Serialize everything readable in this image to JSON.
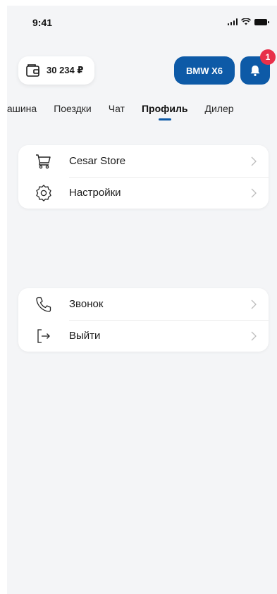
{
  "status_bar": {
    "time": "9:41"
  },
  "header": {
    "balance": "30 234 ₽",
    "car_label": "BMW X6",
    "notification_count": "1"
  },
  "tabs": [
    {
      "label": "Машина",
      "active": false
    },
    {
      "label": "Поездки",
      "active": false
    },
    {
      "label": "Чат",
      "active": false
    },
    {
      "label": "Профиль",
      "active": true
    },
    {
      "label": "Дилер",
      "active": false
    }
  ],
  "menu_group_1": [
    {
      "label": "Cesar Store",
      "icon": "cart-icon"
    },
    {
      "label": "Настройки",
      "icon": "gear-icon"
    }
  ],
  "menu_group_2": [
    {
      "label": "Звонок",
      "icon": "phone-icon"
    },
    {
      "label": "Выйти",
      "icon": "logout-icon"
    }
  ],
  "colors": {
    "accent": "#0d5aa7",
    "badge": "#e8304a",
    "background": "#f4f5f7"
  }
}
